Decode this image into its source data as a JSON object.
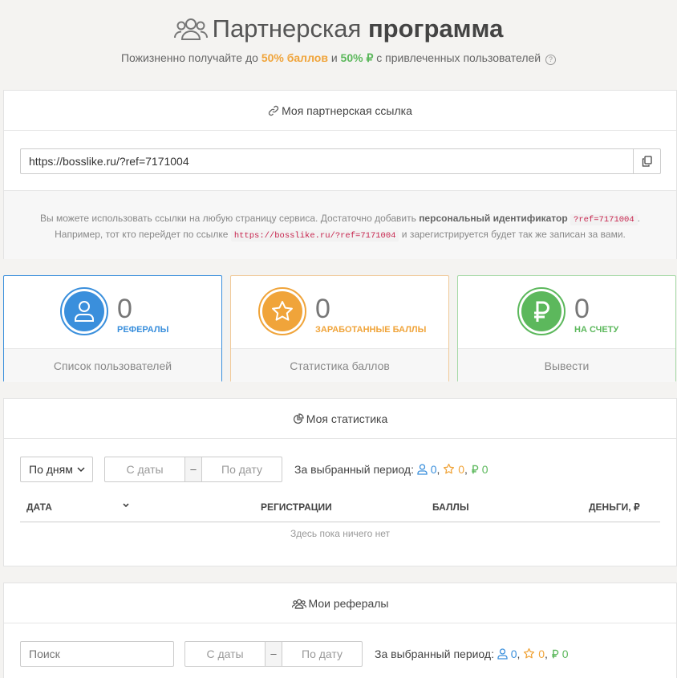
{
  "header": {
    "title_light": "Партнерская",
    "title_bold": "программа",
    "subtitle_pre": "Пожизненно получайте до",
    "subtitle_orange": "50% баллов",
    "subtitle_and": "и",
    "subtitle_green": "50% ₽",
    "subtitle_post": "с привлеченных пользователей",
    "help_glyph": "?"
  },
  "ref_link": {
    "heading": "Моя партнерская ссылка",
    "url": "https://bosslike.ru/?ref=7171004",
    "note_1_pre": "Вы можете использовать ссылки на любую страницу сервиса. Достаточно добавить",
    "note_1_bold": "персональный идентификатор",
    "note_1_code": "?ref=7171004",
    "note_1_end": ".",
    "note_2_pre": "Например, тот кто перейдет по ссылке",
    "note_2_code": "https://bosslike.ru/?ref=7171004",
    "note_2_post": "и зарегистрируется будет так же записан за вами."
  },
  "cards": {
    "referrals": {
      "value": "0",
      "label": "РЕФЕРАЛЫ",
      "footer": "Список пользователей",
      "icon": "user-icon",
      "color": "#3a8fdc"
    },
    "points": {
      "value": "0",
      "label": "ЗАРАБОТАННЫЕ БАЛЛЫ",
      "footer": "Статистика баллов",
      "icon": "star-icon",
      "color": "#f0a43a"
    },
    "money": {
      "value": "0",
      "label": "НА СЧЕТУ",
      "footer": "Вывести",
      "icon": "ruble-icon",
      "color": "#5cb85c"
    }
  },
  "stats": {
    "heading": "Моя статистика",
    "group_by": "По дням",
    "date_from": "С даты",
    "date_sep": "–",
    "date_to": "По дату",
    "period_label": "За выбранный период:",
    "period_users": "0",
    "period_points": "0",
    "period_money": "0",
    "columns": [
      "ДАТА",
      "РЕГИСТРАЦИИ",
      "БАЛЛЫ",
      "ДЕНЬГИ, ₽"
    ],
    "empty": "Здесь пока ничего нет"
  },
  "my_referrals": {
    "heading": "Мои рефералы",
    "search_placeholder": "Поиск",
    "date_from": "С даты",
    "date_sep": "–",
    "date_to": "По дату",
    "period_label": "За выбранный период:",
    "period_users": "0",
    "period_points": "0",
    "period_money": "0"
  }
}
